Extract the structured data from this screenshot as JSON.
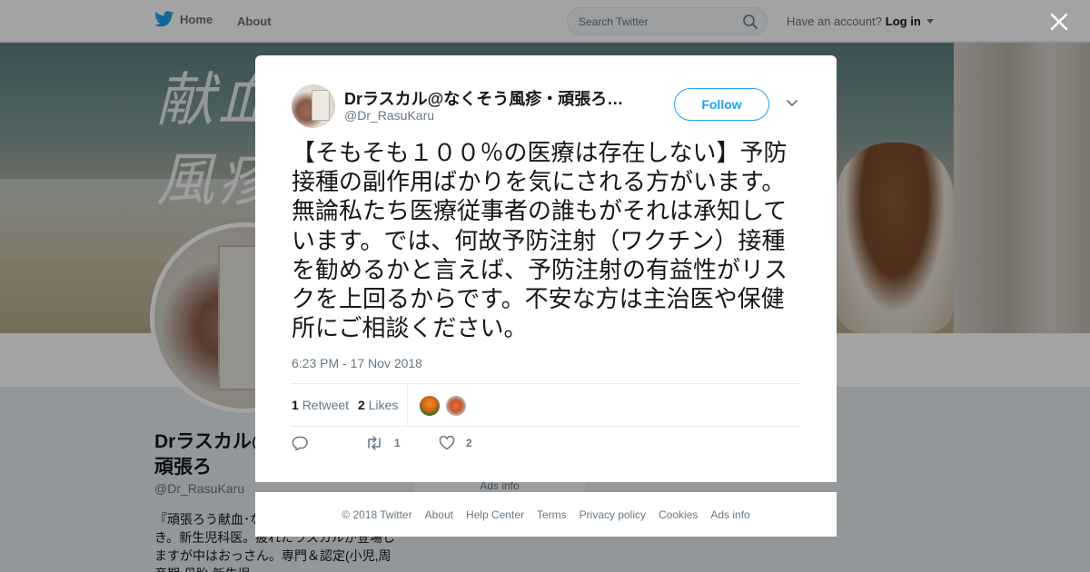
{
  "nav": {
    "home_label": "Home",
    "about_label": "About",
    "search_placeholder": "Search Twitter",
    "account_prompt": "Have an account?",
    "login_label": "Log in"
  },
  "banner": {
    "text_line1": "献血",
    "text_line2": "風疹"
  },
  "profile": {
    "name": "Drラスカル@なくそう風疹・頑張ろ",
    "handle": "@Dr_RasuKaru",
    "bio": "『頑張ろう献血･な【○○】=Bot(自動)呟き。新生児科医。疲れたラスカルが登場しますが中はおっさん。専門＆認定(小児,周産期:母胎,新生児"
  },
  "tweet": {
    "author_name": "Drラスカル@なくそう風疹・頑張ろ…",
    "author_handle": "@Dr_RasuKaru",
    "follow_label": "Follow",
    "text": "【そもそも１００％の医療は存在しない】予防接種の副作用ばかりを気にされる方がいます。無論私たち医療従事者の誰もがそれは承知しています。では、何故予防注射（ワクチン）接種を勧めるかと言えば、予防注射の有益性がリスクを上回るからです。不安な方は主治医や保健所にご相談ください。",
    "timestamp": "6:23 PM - 17 Nov 2018",
    "retweet_count": "1",
    "retweet_label": "Retweet",
    "like_count": "2",
    "like_label": "Likes",
    "action_retweet_count": "1",
    "action_like_count": "2"
  },
  "ads_info_behind": "Ads info",
  "footer": {
    "copyright": "© 2018 Twitter",
    "about": "About",
    "help": "Help Center",
    "terms": "Terms",
    "privacy": "Privacy policy",
    "cookies": "Cookies",
    "ads": "Ads info"
  },
  "colors": {
    "accent": "#1da1f2",
    "text_primary": "#14171a",
    "text_secondary": "#657786"
  },
  "icons": {
    "logo": "twitter-bird-icon",
    "search": "search-icon",
    "close": "close-icon",
    "more": "chevron-down-icon",
    "reply": "reply-icon",
    "retweet": "retweet-icon",
    "like": "heart-icon"
  }
}
